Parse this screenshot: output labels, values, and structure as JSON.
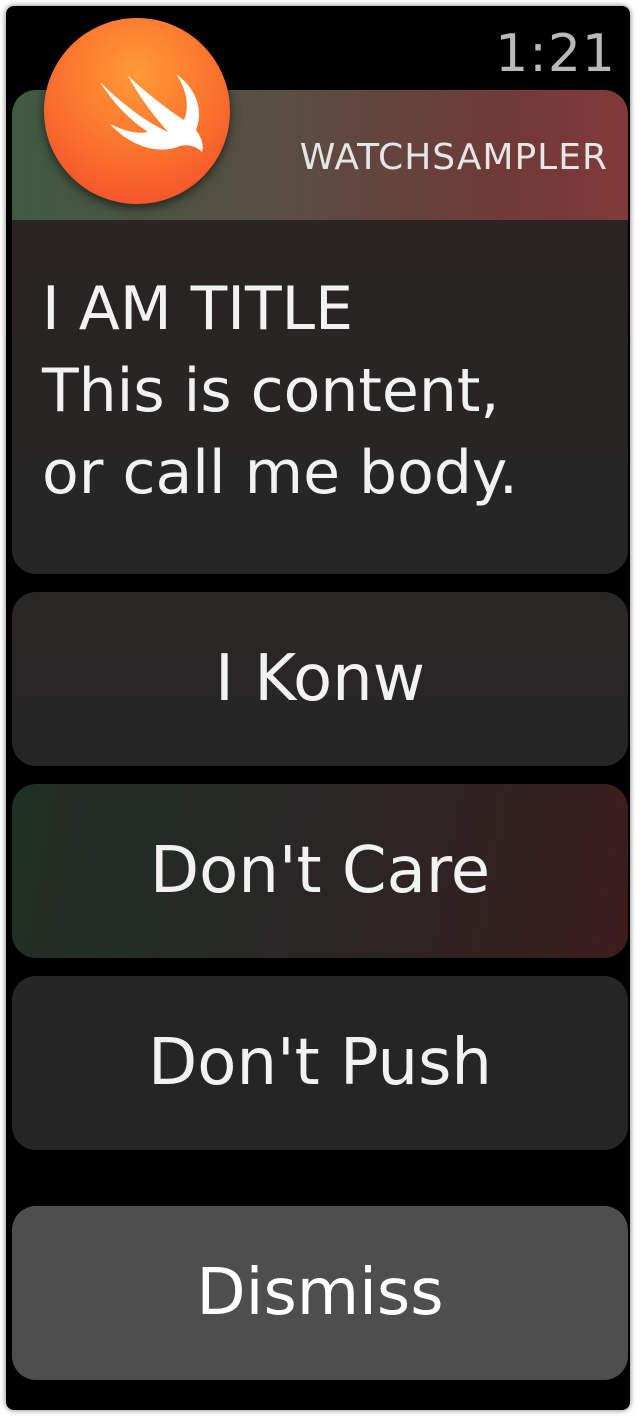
{
  "status_bar": {
    "time": "1:21"
  },
  "notification": {
    "app_name": "WATCHSAMPLER",
    "app_icon": "swift-bird-icon",
    "title": "I AM TITLE",
    "body_lines": [
      "This is content,",
      "or call me body."
    ]
  },
  "actions": [
    {
      "label": "I Konw"
    },
    {
      "label": "Don't Care"
    },
    {
      "label": "Don't Push"
    }
  ],
  "dismiss_label": "Dismiss",
  "colors": {
    "icon_orange": "#fa6e2c",
    "background": "#000000",
    "button": "#262626",
    "dismiss_button": "#4e4e4e"
  }
}
